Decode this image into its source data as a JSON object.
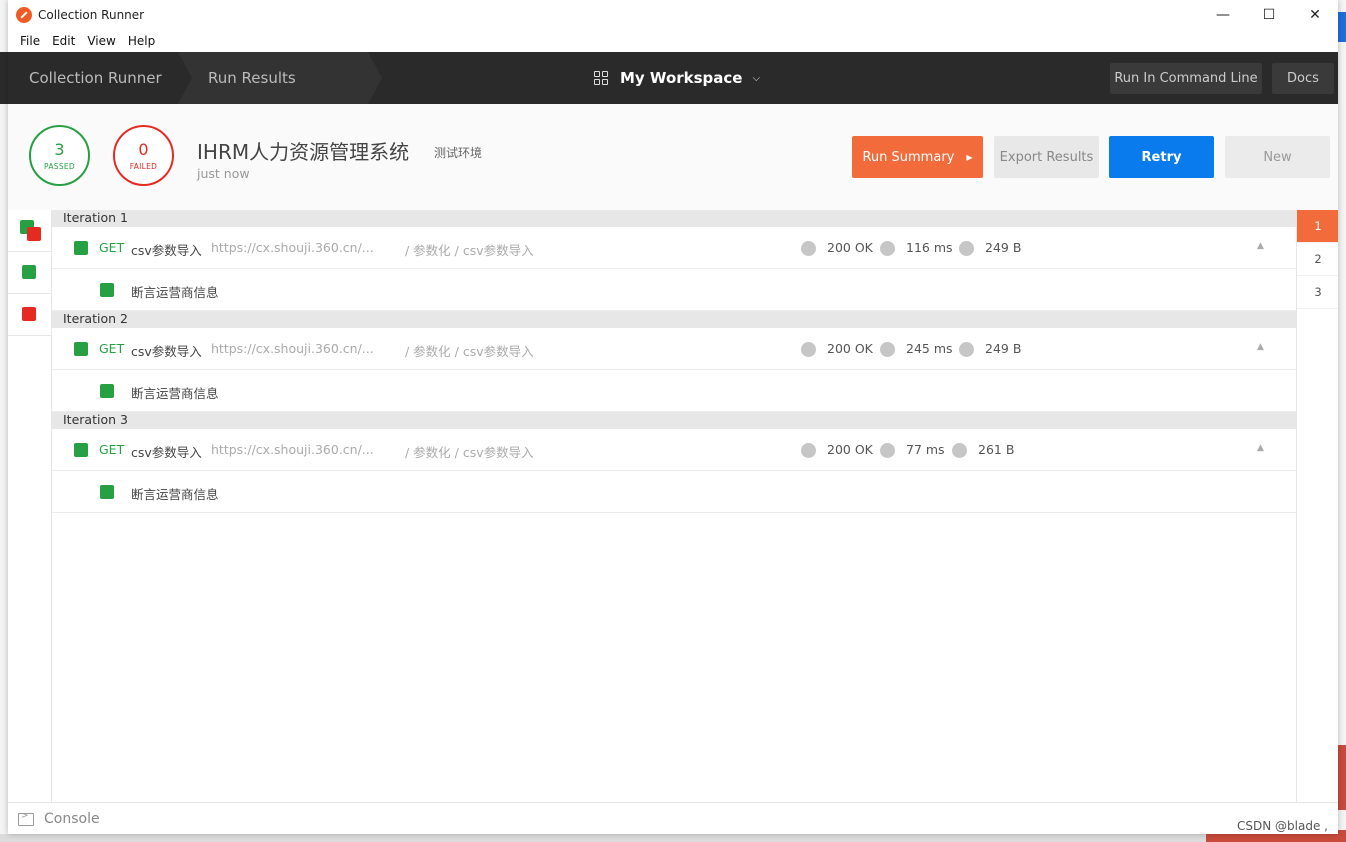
{
  "window": {
    "title": "Collection Runner",
    "minimize": "—",
    "maximize": "☐",
    "close": "✕"
  },
  "menu": [
    "File",
    "Edit",
    "View",
    "Help"
  ],
  "header": {
    "crumbs": [
      "Collection Runner",
      "Run Results"
    ],
    "workspace": "My Workspace",
    "workspace_chevron": "⌵",
    "cmd_button": "Run In Command Line",
    "docs_button": "Docs"
  },
  "summary": {
    "passed_count": "3",
    "passed_label": "PASSED",
    "failed_count": "0",
    "failed_label": "FAILED",
    "collection_name": "IHRM人力资源管理系统",
    "environment": "测试环境",
    "run_time": "just now",
    "buttons": {
      "summary": "Run Summary",
      "export": "Export Results",
      "retry": "Retry",
      "new": "New"
    }
  },
  "colors": {
    "accent": "#f26b3a",
    "primary": "#097bed",
    "pass": "#27a043",
    "fail": "#e52a21"
  },
  "iterations": [
    {
      "label": "Iteration 1",
      "request": {
        "method": "GET",
        "name": "csv参数导入",
        "url": "https://cx.shouji.360.cn/...",
        "path": "/ 参数化 / csv参数导入",
        "status": "200 OK",
        "time": "116 ms",
        "size": "249 B"
      },
      "test": "断言运营商信息"
    },
    {
      "label": "Iteration 2",
      "request": {
        "method": "GET",
        "name": "csv参数导入",
        "url": "https://cx.shouji.360.cn/...",
        "path": "/ 参数化 / csv参数导入",
        "status": "200 OK",
        "time": "245 ms",
        "size": "249 B"
      },
      "test": "断言运营商信息"
    },
    {
      "label": "Iteration 3",
      "request": {
        "method": "GET",
        "name": "csv参数导入",
        "url": "https://cx.shouji.360.cn/...",
        "path": "/ 参数化 / csv参数导入",
        "status": "200 OK",
        "time": "77 ms",
        "size": "261 B"
      },
      "test": "断言运营商信息"
    }
  ],
  "iteration_nav": [
    "1",
    "2",
    "3"
  ],
  "collapse_glyph": "▲",
  "footer": {
    "console": "Console"
  },
  "watermark": "CSDN @blade ,"
}
